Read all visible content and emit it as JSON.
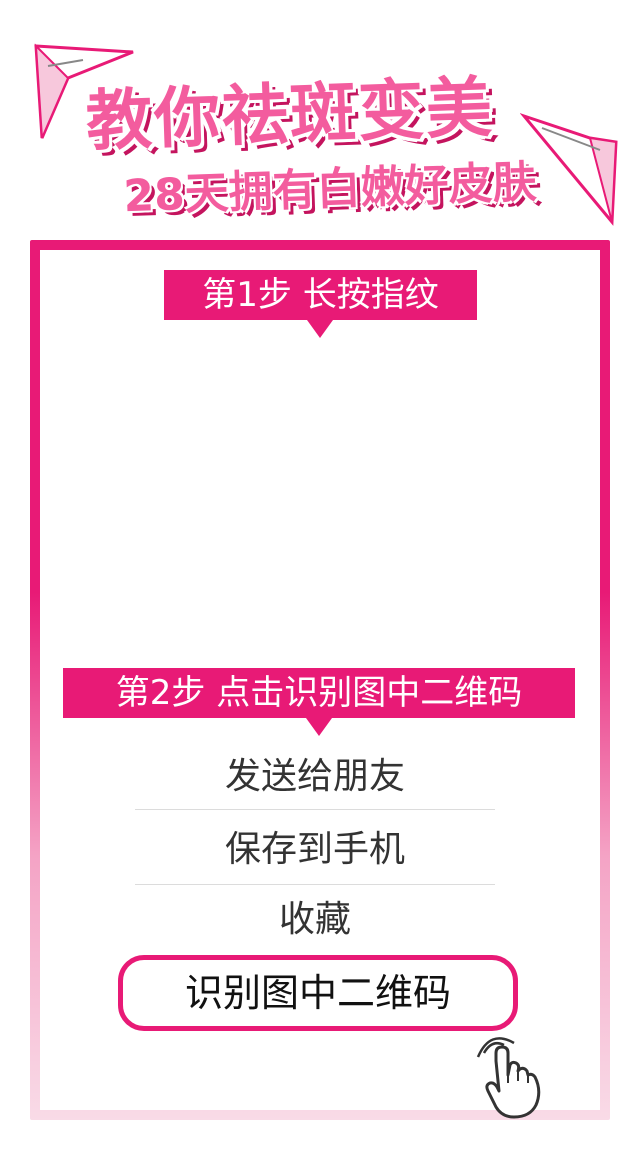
{
  "header": {
    "title": "教你祛斑变美",
    "subtitle": "28天拥有白嫩好皮肤"
  },
  "steps": [
    {
      "label": "第1步  长按指纹"
    },
    {
      "label": "第2步 点击识别图中二维码"
    }
  ],
  "menu": {
    "items": [
      {
        "label": "发送给朋友"
      },
      {
        "label": "保存到手机"
      },
      {
        "label": "收藏"
      }
    ],
    "highlighted": {
      "label": "识别图中二维码"
    }
  },
  "icons": {
    "left_decoration": "paper-plane-icon",
    "right_decoration": "paper-plane-icon",
    "pointer": "tap-hand-icon"
  },
  "colors": {
    "accent": "#e81a76",
    "title_pink": "#f35c9e",
    "title_shadow": "#c4145e",
    "text": "#333333"
  }
}
